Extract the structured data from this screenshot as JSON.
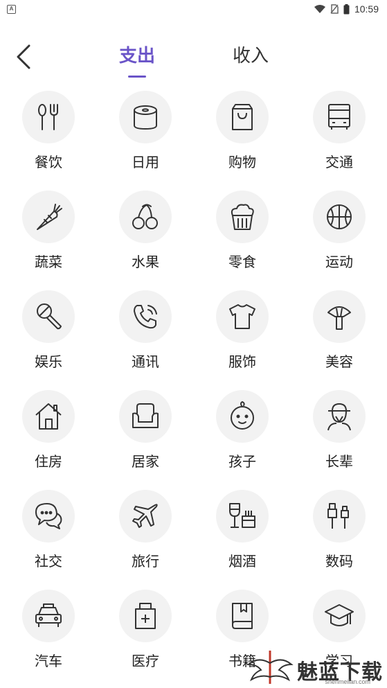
{
  "status_bar": {
    "time": "10:59",
    "notification_letter": "A"
  },
  "header": {
    "tabs": [
      {
        "label": "支出"
      },
      {
        "label": "收入"
      }
    ],
    "active_tab": "支出",
    "accent_color": "#6a54c8"
  },
  "categories": [
    {
      "label": "餐饮",
      "icon": "utensils-icon"
    },
    {
      "label": "日用",
      "icon": "tissue-roll-icon"
    },
    {
      "label": "购物",
      "icon": "shopping-bag-icon"
    },
    {
      "label": "交通",
      "icon": "bus-icon"
    },
    {
      "label": "蔬菜",
      "icon": "carrot-icon"
    },
    {
      "label": "水果",
      "icon": "cherry-icon"
    },
    {
      "label": "零食",
      "icon": "cupcake-icon"
    },
    {
      "label": "运动",
      "icon": "basketball-icon"
    },
    {
      "label": "娱乐",
      "icon": "microphone-icon"
    },
    {
      "label": "通讯",
      "icon": "phone-icon"
    },
    {
      "label": "服饰",
      "icon": "tshirt-icon"
    },
    {
      "label": "美容",
      "icon": "makeup-brush-icon"
    },
    {
      "label": "住房",
      "icon": "house-icon"
    },
    {
      "label": "居家",
      "icon": "sofa-icon"
    },
    {
      "label": "孩子",
      "icon": "baby-icon"
    },
    {
      "label": "长辈",
      "icon": "elder-icon"
    },
    {
      "label": "社交",
      "icon": "chat-bubbles-icon"
    },
    {
      "label": "旅行",
      "icon": "airplane-icon"
    },
    {
      "label": "烟酒",
      "icon": "wine-cigarette-icon"
    },
    {
      "label": "数码",
      "icon": "usb-cable-icon"
    },
    {
      "label": "汽车",
      "icon": "car-icon"
    },
    {
      "label": "医疗",
      "icon": "medical-kit-icon"
    },
    {
      "label": "书籍",
      "icon": "book-icon"
    },
    {
      "label": "学习",
      "icon": "graduation-cap-icon"
    }
  ],
  "watermark": {
    "text": "魅蓝下载",
    "url": "shenmeilan.com"
  }
}
